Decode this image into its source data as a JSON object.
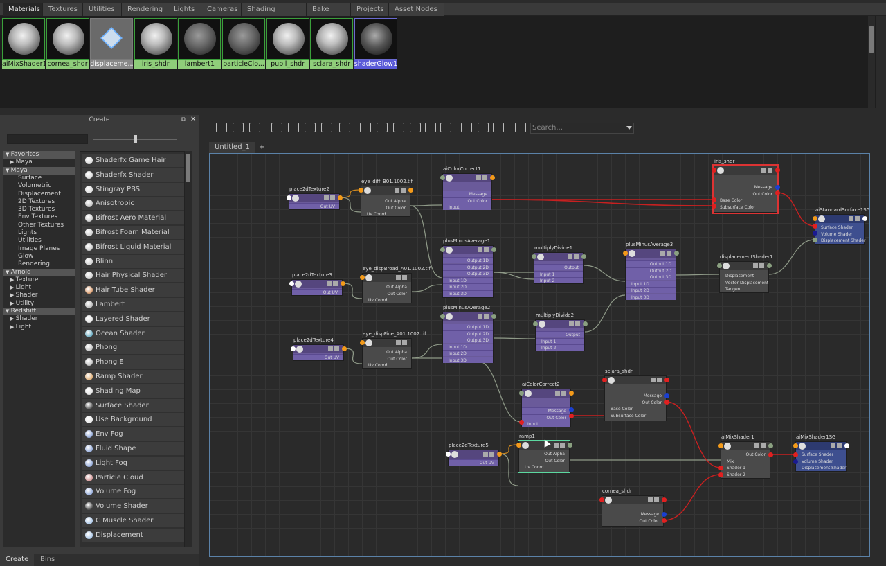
{
  "top_tabs": [
    "Materials",
    "Textures",
    "Utilities",
    "Rendering",
    "Lights",
    "Cameras",
    "Shading Groups",
    "Bake Sets",
    "Projects",
    "Asset Nodes"
  ],
  "thumbnails": [
    {
      "label": "aiMixShader1",
      "style": "normal"
    },
    {
      "label": "cornea_shdr",
      "style": "normal"
    },
    {
      "label": "displaceme...",
      "style": "selected"
    },
    {
      "label": "iris_shdr",
      "style": "normal"
    },
    {
      "label": "lambert1",
      "style": "normal"
    },
    {
      "label": "particleClo...",
      "style": "normal"
    },
    {
      "label": "pupil_shdr",
      "style": "normal"
    },
    {
      "label": "sclara_shdr",
      "style": "normal"
    },
    {
      "label": "shaderGlow1",
      "style": "blue"
    }
  ],
  "create_panel": {
    "header": "Create",
    "tree": [
      {
        "label": "Favorites",
        "cat": true,
        "arrow": "▼"
      },
      {
        "label": "Maya",
        "cat": false,
        "arrow": "▶",
        "indent": 1
      },
      {
        "label": "Maya",
        "cat": true,
        "arrow": "▼"
      },
      {
        "label": "Surface",
        "indent": 2
      },
      {
        "label": "Volumetric",
        "indent": 2
      },
      {
        "label": "Displacement",
        "indent": 2
      },
      {
        "label": "2D Textures",
        "indent": 2
      },
      {
        "label": "3D Textures",
        "indent": 2
      },
      {
        "label": "Env Textures",
        "indent": 2
      },
      {
        "label": "Other Textures",
        "indent": 2
      },
      {
        "label": "Lights",
        "indent": 2
      },
      {
        "label": "Utilities",
        "indent": 2
      },
      {
        "label": "Image Planes",
        "indent": 2
      },
      {
        "label": "Glow",
        "indent": 2
      },
      {
        "label": "Rendering",
        "indent": 2
      },
      {
        "label": "Arnold",
        "cat": true,
        "arrow": "▼"
      },
      {
        "label": "Texture",
        "arrow": "▶",
        "indent": 1
      },
      {
        "label": "Light",
        "arrow": "▶",
        "indent": 1
      },
      {
        "label": "Shader",
        "arrow": "▶",
        "indent": 1
      },
      {
        "label": "Utility",
        "arrow": "▶",
        "indent": 1
      },
      {
        "label": "Redshift",
        "cat": true,
        "arrow": "▼"
      },
      {
        "label": "Shader",
        "arrow": "▶",
        "indent": 1
      },
      {
        "label": "Light",
        "arrow": "▶",
        "indent": 1
      }
    ],
    "items": [
      "Shaderfx Game Hair",
      "Shaderfx Shader",
      "Stingray PBS",
      "Anisotropic",
      "Bifrost Aero Material",
      "Bifrost Foam Material",
      "Bifrost Liquid Material",
      "Blinn",
      "Hair Physical Shader",
      "Hair Tube Shader",
      "Lambert",
      "Layered Shader",
      "Ocean Shader",
      "Phong",
      "Phong E",
      "Ramp Shader",
      "Shading Map",
      "Surface Shader",
      "Use Background",
      "Env Fog",
      "Fluid Shape",
      "Light Fog",
      "Particle Cloud",
      "Volume Fog",
      "Volume Shader",
      "C Muscle Shader",
      "Displacement"
    ],
    "bottom_tabs": [
      "Create",
      "Bins"
    ]
  },
  "graph": {
    "search_placeholder": "Search...",
    "tabs": [
      "Untitled_1",
      "+"
    ]
  },
  "nodes": {
    "place2dTexture2": {
      "title": "place2dTexture2",
      "ports": [
        "Out UV"
      ]
    },
    "eye_diff": {
      "title": "eye_diff_B01.1002.tif",
      "ports": [
        "Out Alpha",
        "Out Color",
        "Uv Coord"
      ]
    },
    "aiColorCorrect1": {
      "title": "aiColorCorrect1",
      "ports": [
        "Message",
        "Out Color",
        "Input"
      ]
    },
    "iris_shdr": {
      "title": "iris_shdr",
      "ports": [
        "Message",
        "Out Color",
        "Base Color",
        "Subsurface Color"
      ]
    },
    "aiStandardSurface1SG": {
      "title": "aiStandardSurface1SG",
      "ports": [
        "Surface Shader",
        "Volume Shader",
        "Displacement Shader"
      ]
    },
    "place2dTexture3": {
      "title": "place2dTexture3",
      "ports": [
        "Out UV"
      ]
    },
    "eye_dispBroad": {
      "title": "eye_dispBroad_A01.1002.tif",
      "ports": [
        "Out Alpha",
        "Out Color",
        "Uv Coord"
      ]
    },
    "plusMinusAverage1": {
      "title": "plusMinusAverage1",
      "ports": [
        "Output 1D",
        "Output 2D",
        "Output 3D",
        "Input 1D",
        "Input 2D",
        "Input 3D"
      ]
    },
    "multiplyDivide1": {
      "title": "multiplyDivide1",
      "ports": [
        "Output",
        "Input 1",
        "Input 2"
      ]
    },
    "plusMinusAverage3": {
      "title": "plusMinusAverage3",
      "ports": [
        "Output 1D",
        "Output 2D",
        "Output 3D",
        "Input 1D",
        "Input 2D",
        "Input 3D"
      ]
    },
    "displacementShader1": {
      "title": "displacementShader1",
      "ports": [
        "Displacement",
        "Vector Displacement",
        "Tangent"
      ]
    },
    "place2dTexture4": {
      "title": "place2dTexture4",
      "ports": [
        "Out UV"
      ]
    },
    "eye_dispFine": {
      "title": "eye_dispFine_A01.1002.tif",
      "ports": [
        "Out Alpha",
        "Out Color",
        "Uv Coord"
      ]
    },
    "plusMinusAverage2": {
      "title": "plusMinusAverage2",
      "ports": [
        "Output 1D",
        "Output 2D",
        "Output 3D",
        "Input 1D",
        "Input 2D",
        "Input 3D"
      ]
    },
    "multiplyDivide2": {
      "title": "multiplyDivide2",
      "ports": [
        "Output",
        "Input 1",
        "Input 2"
      ]
    },
    "sclara_shdr": {
      "title": "sclara_shdr",
      "ports": [
        "Message",
        "Out Color",
        "Base Color",
        "Subsurface Color"
      ]
    },
    "aiColorCorrect2": {
      "title": "aiColorCorrect2",
      "ports": [
        "Message",
        "Out Color",
        "Input"
      ]
    },
    "place2dTexture5": {
      "title": "place2dTexture5",
      "ports": [
        "Out UV"
      ]
    },
    "ramp1": {
      "title": "ramp1",
      "ports": [
        "Out Alpha",
        "Out Color",
        "Uv Coord"
      ]
    },
    "aiMixShader1": {
      "title": "aiMixShader1",
      "ports": [
        "Out Color",
        "Mix",
        "Shader 1",
        "Shader 2"
      ]
    },
    "aiMixShader1SG": {
      "title": "aiMixShader1SG",
      "ports": [
        "Surface Shader",
        "Volume Shader",
        "Displacement Shader"
      ]
    },
    "cornea_shdr": {
      "title": "cornea_shdr",
      "ports": [
        "Message",
        "Out Color"
      ]
    }
  }
}
